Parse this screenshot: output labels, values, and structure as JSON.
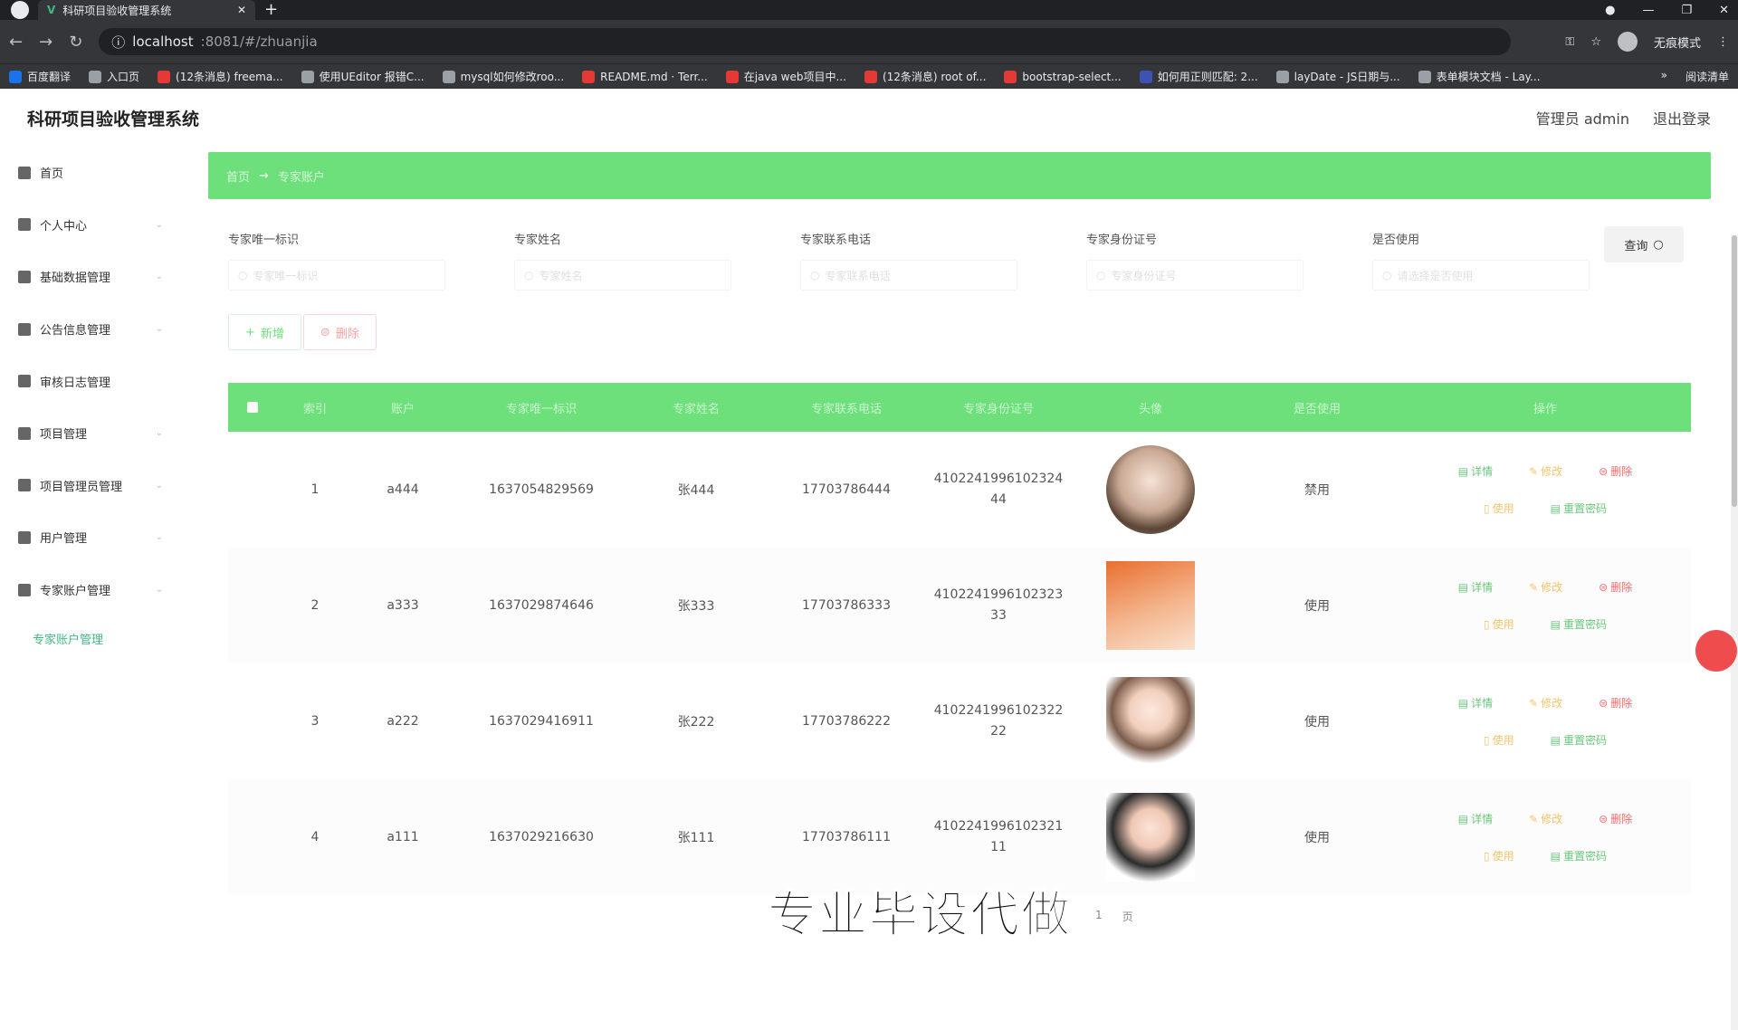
{
  "browser": {
    "tab_title": "科研项目验收管理系统",
    "url_host": "localhost",
    "url_path": ":8081/#/zhuanjia",
    "incognito_label": "无痕模式",
    "bookmarks": [
      {
        "label": "百度翻译",
        "color": "#1a73e8"
      },
      {
        "label": "入口页",
        "color": "#9aa0a6"
      },
      {
        "label": "(12条消息) freema...",
        "color": "#e53935"
      },
      {
        "label": "使用UEditor 报错C...",
        "color": "#9aa0a6"
      },
      {
        "label": "mysql如何修改roo...",
        "color": "#9aa0a6"
      },
      {
        "label": "README.md · Terr...",
        "color": "#e53935"
      },
      {
        "label": "在java web项目中...",
        "color": "#e53935"
      },
      {
        "label": "(12条消息) root of...",
        "color": "#e53935"
      },
      {
        "label": "bootstrap-select...",
        "color": "#e53935"
      },
      {
        "label": "如何用正则匹配: 2...",
        "color": "#3f51b5"
      },
      {
        "label": "layDate - JS日期与...",
        "color": "#9aa0a6"
      },
      {
        "label": "表单模块文档 - Lay...",
        "color": "#9aa0a6"
      }
    ],
    "reading_list": "阅读清单"
  },
  "header": {
    "title": "科研项目验收管理系统",
    "user": "管理员 admin",
    "logout": "退出登录"
  },
  "sidebar": {
    "items": [
      {
        "label": "首页",
        "icon": "home-icon",
        "chevron": false
      },
      {
        "label": "个人中心",
        "icon": "user-icon",
        "chevron": true
      },
      {
        "label": "基础数据管理",
        "icon": "database-icon",
        "chevron": true
      },
      {
        "label": "公告信息管理",
        "icon": "notice-icon",
        "chevron": true
      },
      {
        "label": "审核日志管理",
        "icon": "chart-icon",
        "chevron": false
      },
      {
        "label": "项目管理",
        "icon": "mail-icon",
        "chevron": true
      },
      {
        "label": "项目管理员管理",
        "icon": "settings-icon",
        "chevron": true
      },
      {
        "label": "用户管理",
        "icon": "user-group-icon",
        "chevron": true
      },
      {
        "label": "专家账户管理",
        "icon": "folder-icon",
        "chevron": true
      }
    ],
    "sub_active": "专家账户管理"
  },
  "breadcrumb": {
    "home": "首页",
    "arrow": "→",
    "current": "专家账户"
  },
  "filters": [
    {
      "label": "专家唯一标识",
      "placeholder": "专家唯一标识"
    },
    {
      "label": "专家姓名",
      "placeholder": "专家姓名"
    },
    {
      "label": "专家联系电话",
      "placeholder": "专家联系电话"
    },
    {
      "label": "专家身份证号",
      "placeholder": "专家身份证号"
    },
    {
      "label": "是否使用",
      "placeholder": "请选择是否使用"
    }
  ],
  "search_button": "查询",
  "actions": {
    "add": "新增",
    "delete": "删除"
  },
  "table": {
    "headers": [
      "索引",
      "账户",
      "专家唯一标识",
      "专家姓名",
      "专家联系电话",
      "专家身份证号",
      "头像",
      "是否使用",
      "操作"
    ],
    "rows": [
      {
        "index": "1",
        "account": "a444",
        "uid": "1637054829569",
        "name": "张444",
        "phone": "17703786444",
        "idcard": "410224199610232444",
        "status": "禁用"
      },
      {
        "index": "2",
        "account": "a333",
        "uid": "1637029874646",
        "name": "张333",
        "phone": "17703786333",
        "idcard": "410224199610232333",
        "status": "使用"
      },
      {
        "index": "3",
        "account": "a222",
        "uid": "1637029416911",
        "name": "张222",
        "phone": "17703786222",
        "idcard": "410224199610232222",
        "status": "使用"
      },
      {
        "index": "4",
        "account": "a111",
        "uid": "1637029216630",
        "name": "张111",
        "phone": "17703786111",
        "idcard": "410224199610232111",
        "status": "使用"
      }
    ],
    "ops": {
      "detail": "详情",
      "edit": "修改",
      "remove": "删除",
      "toggle": "使用",
      "reset": "重置密码"
    }
  },
  "overlay_text": "专业毕设代做",
  "pager": {
    "page": "1",
    "unit": "页"
  }
}
